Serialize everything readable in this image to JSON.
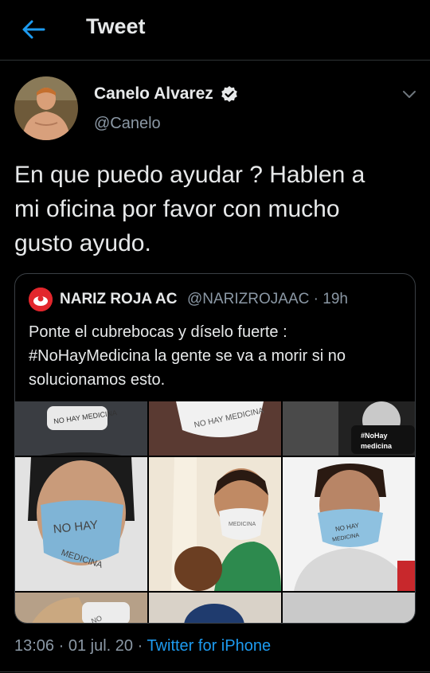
{
  "header": {
    "title": "Tweet"
  },
  "author": {
    "name": "Canelo Alvarez",
    "handle": "@Canelo",
    "verified": true
  },
  "tweet": {
    "lines": [
      "En que puedo ayudar ? Hablen a",
      "mi oficina por favor con mucho",
      "gusto ayudo."
    ]
  },
  "quote": {
    "name": "NARIZ ROJA AC",
    "handle": "@NARIZROJAAC",
    "time": "19h",
    "lines": [
      "Ponte el cubrebocas y díselo fuerte :",
      "#NoHayMedicina la gente se va a morir si no",
      "solucionamos esto."
    ],
    "media_texts": {
      "mask1": "NO HAY MEDICINA",
      "mask2": "NO HAY MEDICINA",
      "caption3a": "#NoHay",
      "caption3b": "medicina",
      "mask4a": "NO HAY",
      "mask4b": "MEDICINA",
      "mask5": "MEDICINA",
      "mask6a": "NO HAY",
      "mask6b": "MEDICINA",
      "mask7": "NO"
    }
  },
  "meta": {
    "time": "13:06",
    "date": "01 jul. 20",
    "source": "Twitter for iPhone"
  },
  "colors": {
    "accent": "#1d9bf0",
    "background": "#000000",
    "text": "#e7e9ea",
    "muted": "#8b98a5",
    "mask": "#7fb4d6"
  },
  "icons": {
    "back": "arrow-left-icon",
    "verified": "verified-badge-icon",
    "more": "chevron-down-icon",
    "quote_logo": "nariz-roja-logo"
  }
}
